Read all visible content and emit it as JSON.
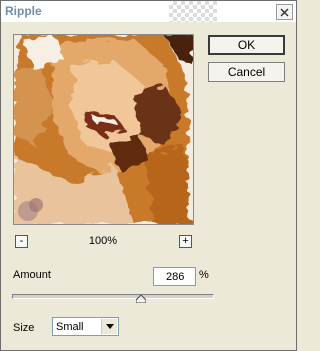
{
  "window": {
    "title": "Ripple"
  },
  "buttons": {
    "ok_label": "OK",
    "cancel_label": "Cancel"
  },
  "preview": {
    "zoom_minus": "-",
    "zoom_plus": "+",
    "zoom_level": "100%"
  },
  "amount": {
    "label": "Amount",
    "value": "286",
    "unit": "%",
    "slider_fraction": 0.64
  },
  "size": {
    "label": "Size",
    "selected": "Small"
  },
  "icons": {
    "close": "close-icon",
    "dropdown": "chevron-down-icon",
    "slider": "slider-thumb-icon"
  }
}
